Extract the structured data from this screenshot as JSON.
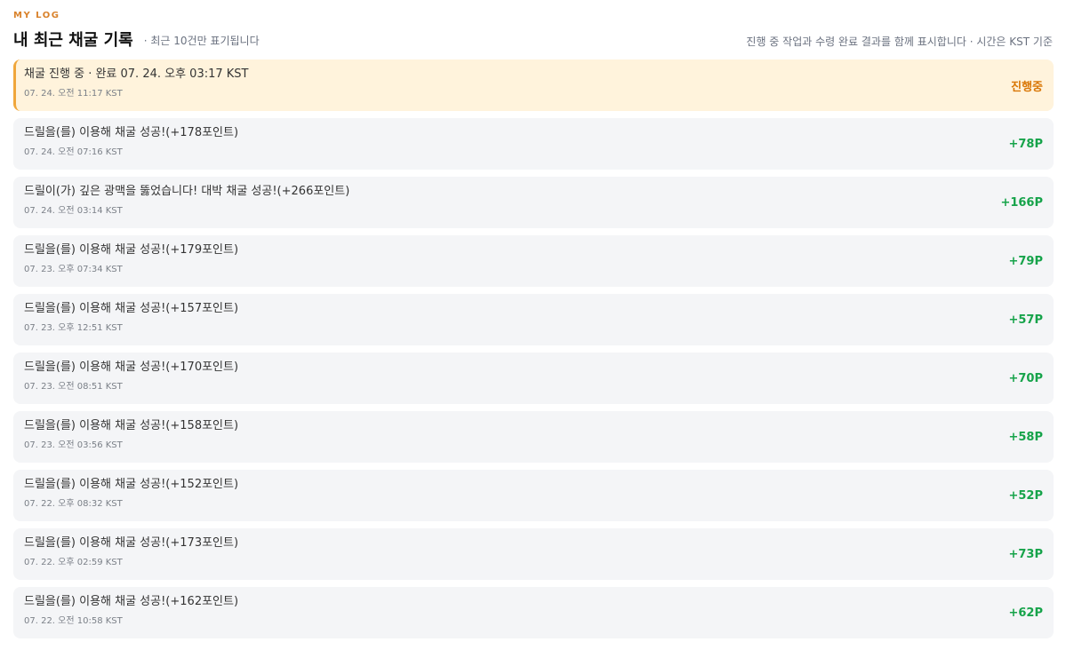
{
  "header": {
    "eyebrow": "MY LOG",
    "title": "내 최근 채굴 기록",
    "subtitle": "· 최근 10건만 표기됩니다",
    "note": "진행 중 작업과 수령 완료 결과를 함께 표시합니다 · 시간은 KST 기준"
  },
  "logs": [
    {
      "title": "채굴 진행 중 · 완료 07. 24. 오후 03:17 KST",
      "time": "07. 24. 오전 11:17 KST",
      "value": "진행중",
      "status": "pending"
    },
    {
      "title": "드릴을(를) 이용해 채굴 성공!(+178포인트)",
      "time": "07. 24. 오전 07:16 KST",
      "value": "+78P",
      "status": "done"
    },
    {
      "title": "드릴이(가) 깊은 광맥을 뚫었습니다! 대박 채굴 성공!(+266포인트)",
      "time": "07. 24. 오전 03:14 KST",
      "value": "+166P",
      "status": "done"
    },
    {
      "title": "드릴을(를) 이용해 채굴 성공!(+179포인트)",
      "time": "07. 23. 오후 07:34 KST",
      "value": "+79P",
      "status": "done"
    },
    {
      "title": "드릴을(를) 이용해 채굴 성공!(+157포인트)",
      "time": "07. 23. 오후 12:51 KST",
      "value": "+57P",
      "status": "done"
    },
    {
      "title": "드릴을(를) 이용해 채굴 성공!(+170포인트)",
      "time": "07. 23. 오전 08:51 KST",
      "value": "+70P",
      "status": "done"
    },
    {
      "title": "드릴을(를) 이용해 채굴 성공!(+158포인트)",
      "time": "07. 23. 오전 03:56 KST",
      "value": "+58P",
      "status": "done"
    },
    {
      "title": "드릴을(를) 이용해 채굴 성공!(+152포인트)",
      "time": "07. 22. 오후 08:32 KST",
      "value": "+52P",
      "status": "done"
    },
    {
      "title": "드릴을(를) 이용해 채굴 성공!(+173포인트)",
      "time": "07. 22. 오후 02:59 KST",
      "value": "+73P",
      "status": "done"
    },
    {
      "title": "드릴을(를) 이용해 채굴 성공!(+162포인트)",
      "time": "07. 22. 오전 10:58 KST",
      "value": "+62P",
      "status": "done"
    }
  ]
}
